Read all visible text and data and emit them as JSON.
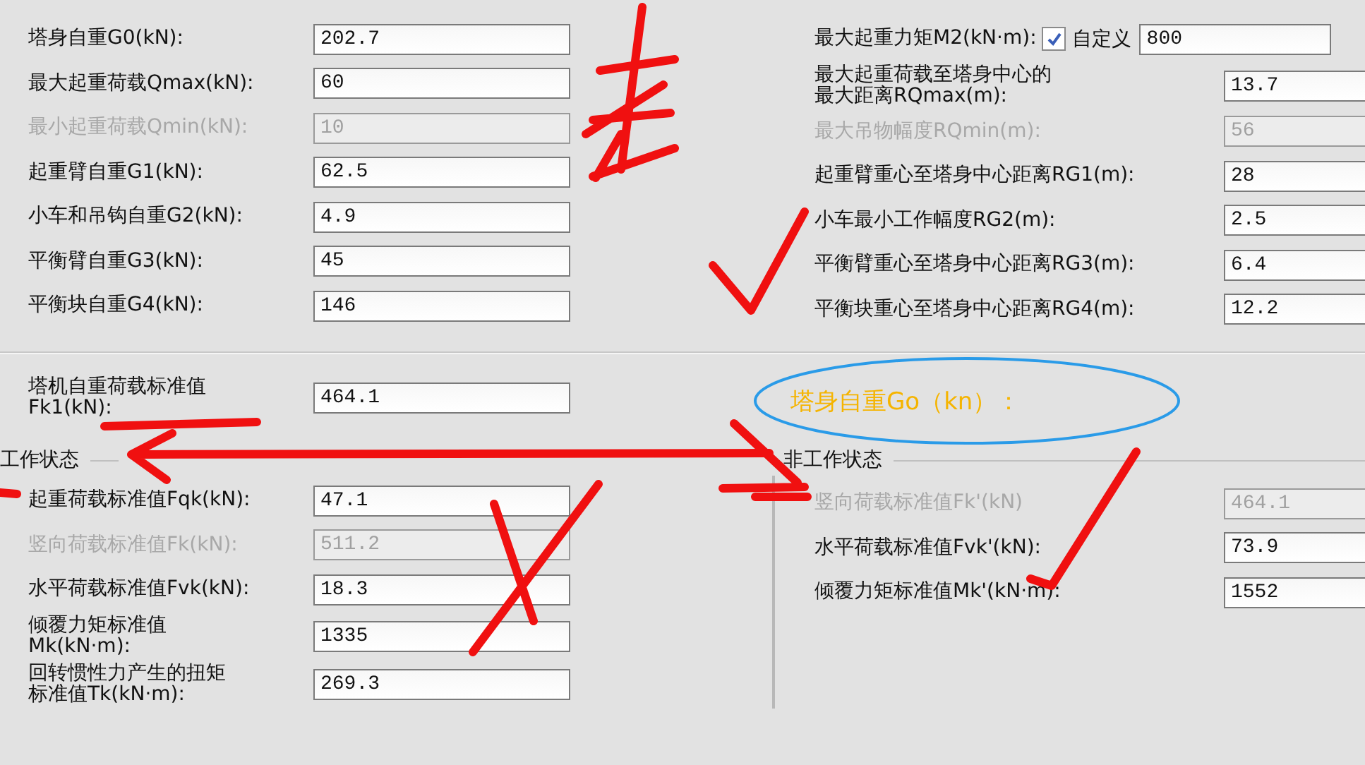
{
  "top_left": [
    {
      "label": [
        "塔身自重G0(kN):"
      ],
      "value": "202.7",
      "disabled": false
    },
    {
      "label": [
        "最大起重荷载Qmax(kN):"
      ],
      "value": "60",
      "disabled": false
    },
    {
      "label": [
        "最小起重荷载Qmin(kN):"
      ],
      "value": "10",
      "disabled": true
    },
    {
      "label": [
        "起重臂自重G1(kN):"
      ],
      "value": "62.5",
      "disabled": false
    },
    {
      "label": [
        "小车和吊钩自重G2(kN):"
      ],
      "value": "4.9",
      "disabled": false
    },
    {
      "label": [
        "平衡臂自重G3(kN):"
      ],
      "value": "45",
      "disabled": false
    },
    {
      "label": [
        "平衡块自重G4(kN):"
      ],
      "value": "146",
      "disabled": false
    }
  ],
  "top_right": [
    {
      "label": [
        "最大起重力矩M2(kN·m):"
      ],
      "value": "800",
      "disabled": false,
      "checkbox": {
        "label": "自定义",
        "checked": true
      }
    },
    {
      "label": [
        "最大起重荷载至塔身中心的",
        "最大距离RQmax(m):"
      ],
      "value": "13.7",
      "disabled": false
    },
    {
      "label": [
        "最大吊物幅度RQmin(m):"
      ],
      "value": "56",
      "disabled": true
    },
    {
      "label": [
        "起重臂重心至塔身中心距离RG1(m):"
      ],
      "value": "28",
      "disabled": false
    },
    {
      "label": [
        "小车最小工作幅度RG2(m):"
      ],
      "value": "2.5",
      "disabled": false
    },
    {
      "label": [
        "平衡臂重心至塔身中心距离RG3(m):"
      ],
      "value": "6.4",
      "disabled": false
    },
    {
      "label": [
        "平衡块重心至塔身中心距离RG4(m):"
      ],
      "value": "12.2",
      "disabled": false
    }
  ],
  "self_weight": {
    "label": [
      "塔机自重荷载标准值",
      "Fk1(kN):"
    ],
    "value": "464.1",
    "disabled": false
  },
  "working_state": {
    "title": "工作状态",
    "rows": [
      {
        "label": [
          "起重荷载标准值Fqk(kN):"
        ],
        "value": "47.1",
        "disabled": false
      },
      {
        "label": [
          "竖向荷载标准值Fk(kN):"
        ],
        "value": "511.2",
        "disabled": true
      },
      {
        "label": [
          "水平荷载标准值Fvk(kN):"
        ],
        "value": "18.3",
        "disabled": false
      },
      {
        "label": [
          "倾覆力矩标准值",
          "Mk(kN·m):"
        ],
        "value": "1335",
        "disabled": false
      },
      {
        "label": [
          "回转惯性力产生的扭矩",
          "标准值Tk(kN·m):"
        ],
        "value": "269.3",
        "disabled": false
      }
    ]
  },
  "non_working_state": {
    "title": "非工作状态",
    "rows": [
      {
        "label": [
          "竖向荷载标准值Fk'(kN)"
        ],
        "value": "464.1",
        "disabled": true
      },
      {
        "label": [
          "水平荷载标准值Fvk'(kN):"
        ],
        "value": "73.9",
        "disabled": false
      },
      {
        "label": [
          "倾覆力矩标准值Mk'(kN·m):"
        ],
        "value": "1552",
        "disabled": false
      }
    ]
  },
  "annotation": {
    "text": "塔身自重Go（kn）："
  }
}
